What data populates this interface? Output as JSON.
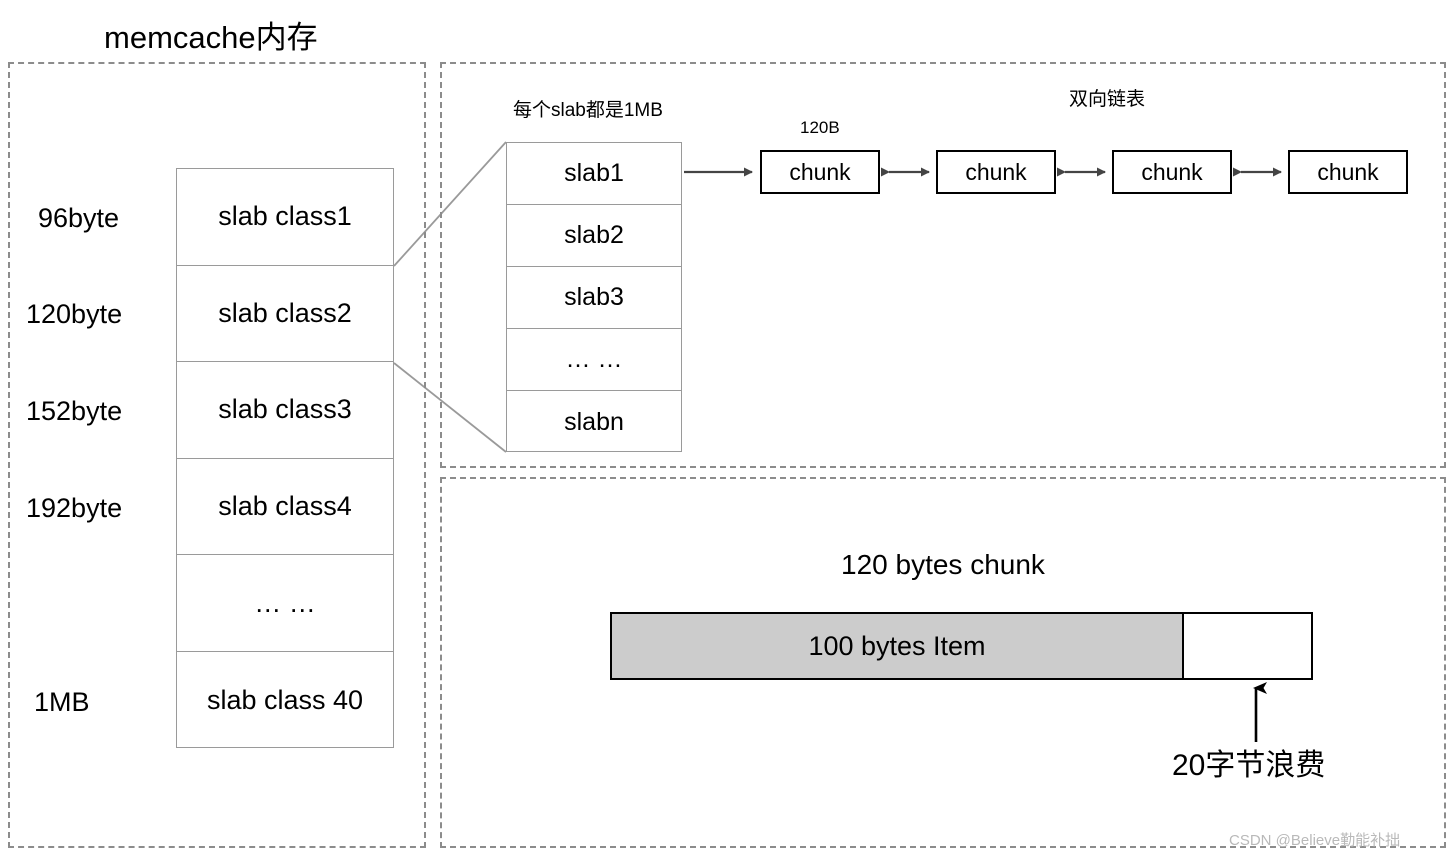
{
  "diagram": {
    "title": "memcache内存",
    "watermark": "CSDN @Believe勤能补拙"
  },
  "left_panel": {
    "size_labels": [
      "96byte",
      "120byte",
      "152byte",
      "192byte",
      "",
      "1MB"
    ],
    "rows": [
      "slab class1",
      "slab class2",
      "slab class3",
      "slab class4",
      "… …",
      "slab class 40"
    ]
  },
  "middle_panel": {
    "caption": "每个slab都是1MB",
    "slabs": [
      "slab1",
      "slab2",
      "slab3",
      "… …",
      "slabn"
    ],
    "chain_title": "双向链表",
    "chunk_size_label": "120B",
    "chunks": [
      "chunk",
      "chunk",
      "chunk",
      "chunk"
    ]
  },
  "bottom_panel": {
    "title": "120 bytes chunk",
    "item_label": "100 bytes Item",
    "waste_label": "20字节浪费",
    "item_bytes": 100,
    "chunk_bytes": 120,
    "waste_bytes": 20
  },
  "colors": {
    "panel_border": "#8c8c8c",
    "box_border": "#9a9a9a",
    "chunk_border": "#000000",
    "item_fill": "#cccccc",
    "text": "#000000",
    "watermark": "#b9b9b9"
  }
}
